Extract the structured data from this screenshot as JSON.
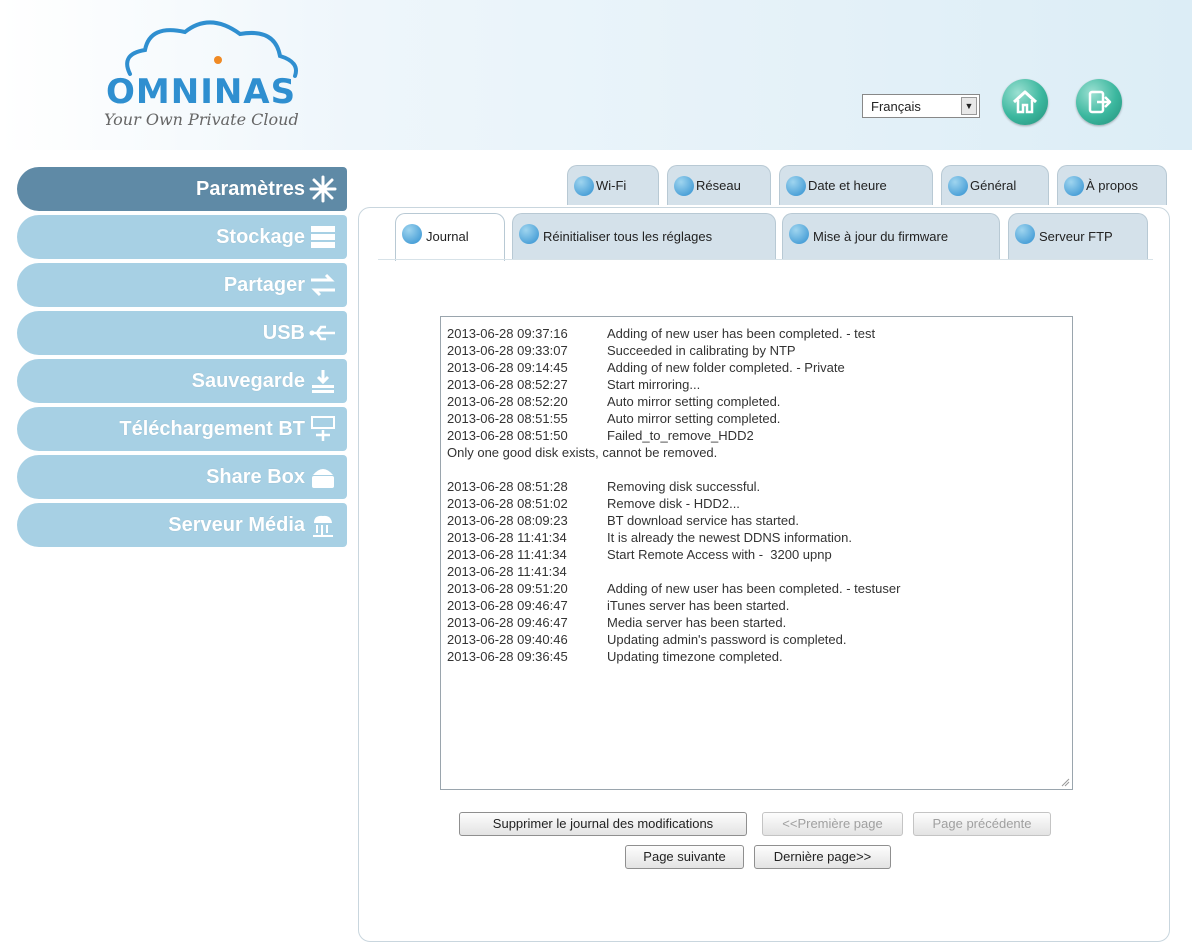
{
  "header": {
    "logo_text": "OMNINAS",
    "tagline": "Your Own Private Cloud",
    "language_selected": "Français",
    "home_icon": "home-icon",
    "logout_icon": "logout-icon"
  },
  "sidebar": {
    "items": [
      {
        "label": "Paramètres",
        "icon": "snowflake-settings-icon",
        "active": true
      },
      {
        "label": "Stockage",
        "icon": "storage-icon"
      },
      {
        "label": "Partager",
        "icon": "share-arrows-icon"
      },
      {
        "label": "USB",
        "icon": "usb-icon"
      },
      {
        "label": "Sauvegarde",
        "icon": "backup-icon"
      },
      {
        "label": "Téléchargement BT",
        "icon": "bt-download-icon"
      },
      {
        "label": "Share Box",
        "icon": "share-box-icon"
      },
      {
        "label": "Serveur Média",
        "icon": "media-server-icon"
      }
    ]
  },
  "tabs_top": [
    {
      "label": "Wi-Fi",
      "icon": "wifi-icon"
    },
    {
      "label": "Réseau",
      "icon": "network-icon"
    },
    {
      "label": "Date et heure",
      "icon": "clock-icon"
    },
    {
      "label": "Général",
      "icon": "general-icon"
    },
    {
      "label": "À propos",
      "icon": "info-icon"
    }
  ],
  "tabs_sub": [
    {
      "label": "Journal",
      "icon": "journal-icon",
      "active": true
    },
    {
      "label": "Réinitialiser tous les réglages",
      "icon": "reset-icon"
    },
    {
      "label": "Mise à jour du firmware",
      "icon": "firmware-icon"
    },
    {
      "label": "Serveur FTP",
      "icon": "ftp-icon"
    }
  ],
  "log": [
    {
      "ts": "2013-06-28 09:37:16",
      "msg": "Adding of new user has been completed. - test"
    },
    {
      "ts": "2013-06-28 09:33:07",
      "msg": "Succeeded in calibrating by NTP"
    },
    {
      "ts": "2013-06-28 09:14:45",
      "msg": "Adding of new folder completed. - Private"
    },
    {
      "ts": "2013-06-28 08:52:27",
      "msg": "Start mirroring..."
    },
    {
      "ts": "2013-06-28 08:52:20",
      "msg": "Auto mirror setting completed."
    },
    {
      "ts": "2013-06-28 08:51:55",
      "msg": "Auto mirror setting completed."
    },
    {
      "ts": "2013-06-28 08:51:50",
      "msg": "Failed_to_remove_HDD2"
    },
    {
      "ts": "",
      "msg": "Only one good disk exists, cannot be removed."
    },
    {
      "ts": "",
      "msg": ""
    },
    {
      "ts": "2013-06-28 08:51:28",
      "msg": "Removing disk successful."
    },
    {
      "ts": "2013-06-28 08:51:02",
      "msg": "Remove disk - HDD2..."
    },
    {
      "ts": "2013-06-28 08:09:23",
      "msg": "BT download service has started."
    },
    {
      "ts": "2013-06-28 11:41:34",
      "msg": "It is already the newest DDNS information."
    },
    {
      "ts": "2013-06-28 11:41:34",
      "msg": "Start Remote Access with -  3200 upnp"
    },
    {
      "ts": "2013-06-28 11:41:34",
      "msg": ""
    },
    {
      "ts": "2013-06-28 09:51:20",
      "msg": "Adding of new user has been completed. - testuser"
    },
    {
      "ts": "2013-06-28 09:46:47",
      "msg": "iTunes server has been started."
    },
    {
      "ts": "2013-06-28 09:46:47",
      "msg": "Media server has been started."
    },
    {
      "ts": "2013-06-28 09:40:46",
      "msg": "Updating admin's password is completed."
    },
    {
      "ts": "2013-06-28 09:36:45",
      "msg": "Updating timezone completed."
    }
  ],
  "buttons": {
    "clear_log": "Supprimer le journal des modifications",
    "first_page": "<<Première page",
    "prev_page": "Page précédente",
    "next_page": "Page suivante",
    "last_page": "Dernière page>>"
  },
  "colors": {
    "accent": "#2f8fd0",
    "sidebar_active": "#5f8aa6",
    "sidebar_item": "#a7d0e4",
    "home_button": "#3bb79e"
  }
}
